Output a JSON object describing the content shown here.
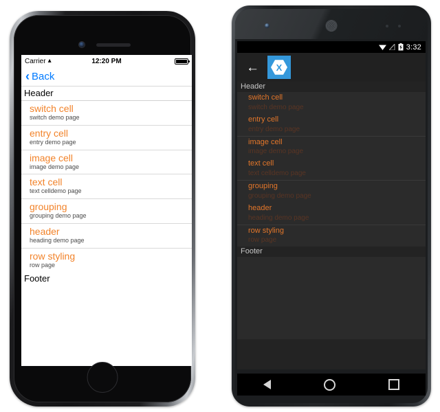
{
  "ios": {
    "status": {
      "carrier": "Carrier",
      "wifi_icon": "wifi-icon",
      "time": "12:20 PM",
      "battery_icon": "battery-full-icon"
    },
    "nav": {
      "back_label": "Back",
      "back_chevron_icon": "chevron-left-icon",
      "accent_color": "#007aff"
    },
    "list": {
      "header": "Header",
      "footer": "Footer",
      "title_color": "#f2832a",
      "detail_color": "#4a4a4a",
      "rows": [
        {
          "title": "switch cell",
          "detail": "switch demo page"
        },
        {
          "title": "entry cell",
          "detail": "entry demo page"
        },
        {
          "title": "image cell",
          "detail": "image demo page"
        },
        {
          "title": "text cell",
          "detail": "text celldemo page"
        },
        {
          "title": "grouping",
          "detail": "grouping demo page"
        },
        {
          "title": "header",
          "detail": "heading demo page"
        },
        {
          "title": "row styling",
          "detail": "row page"
        }
      ]
    }
  },
  "android": {
    "status": {
      "wifi_icon": "wifi-icon",
      "signal_icon": "signal-none-icon",
      "battery_icon": "battery-charging-icon",
      "clock": "3:32"
    },
    "appbar": {
      "back_icon": "arrow-left-icon",
      "logo_icon": "xamarin-logo-icon",
      "logo_color": "#3498db"
    },
    "list": {
      "header": "Header",
      "footer": "Footer",
      "title_color": "#e2762a",
      "detail_color": "#5a3524",
      "rows": [
        {
          "title": "switch cell",
          "detail": "switch demo page",
          "separator": false
        },
        {
          "title": "entry cell",
          "detail": "entry demo page",
          "separator": false
        },
        {
          "title": "image cell",
          "detail": "image demo page",
          "separator": true
        },
        {
          "title": "text cell",
          "detail": "text celldemo page",
          "separator": false
        },
        {
          "title": "grouping",
          "detail": "grouping demo page",
          "separator": true
        },
        {
          "title": "header",
          "detail": "heading demo page",
          "separator": false
        },
        {
          "title": "row styling",
          "detail": "row page",
          "separator": true
        }
      ]
    },
    "navbar": {
      "back_icon": "nav-back-triangle-icon",
      "home_icon": "nav-home-circle-icon",
      "recents_icon": "nav-recents-square-icon"
    }
  }
}
